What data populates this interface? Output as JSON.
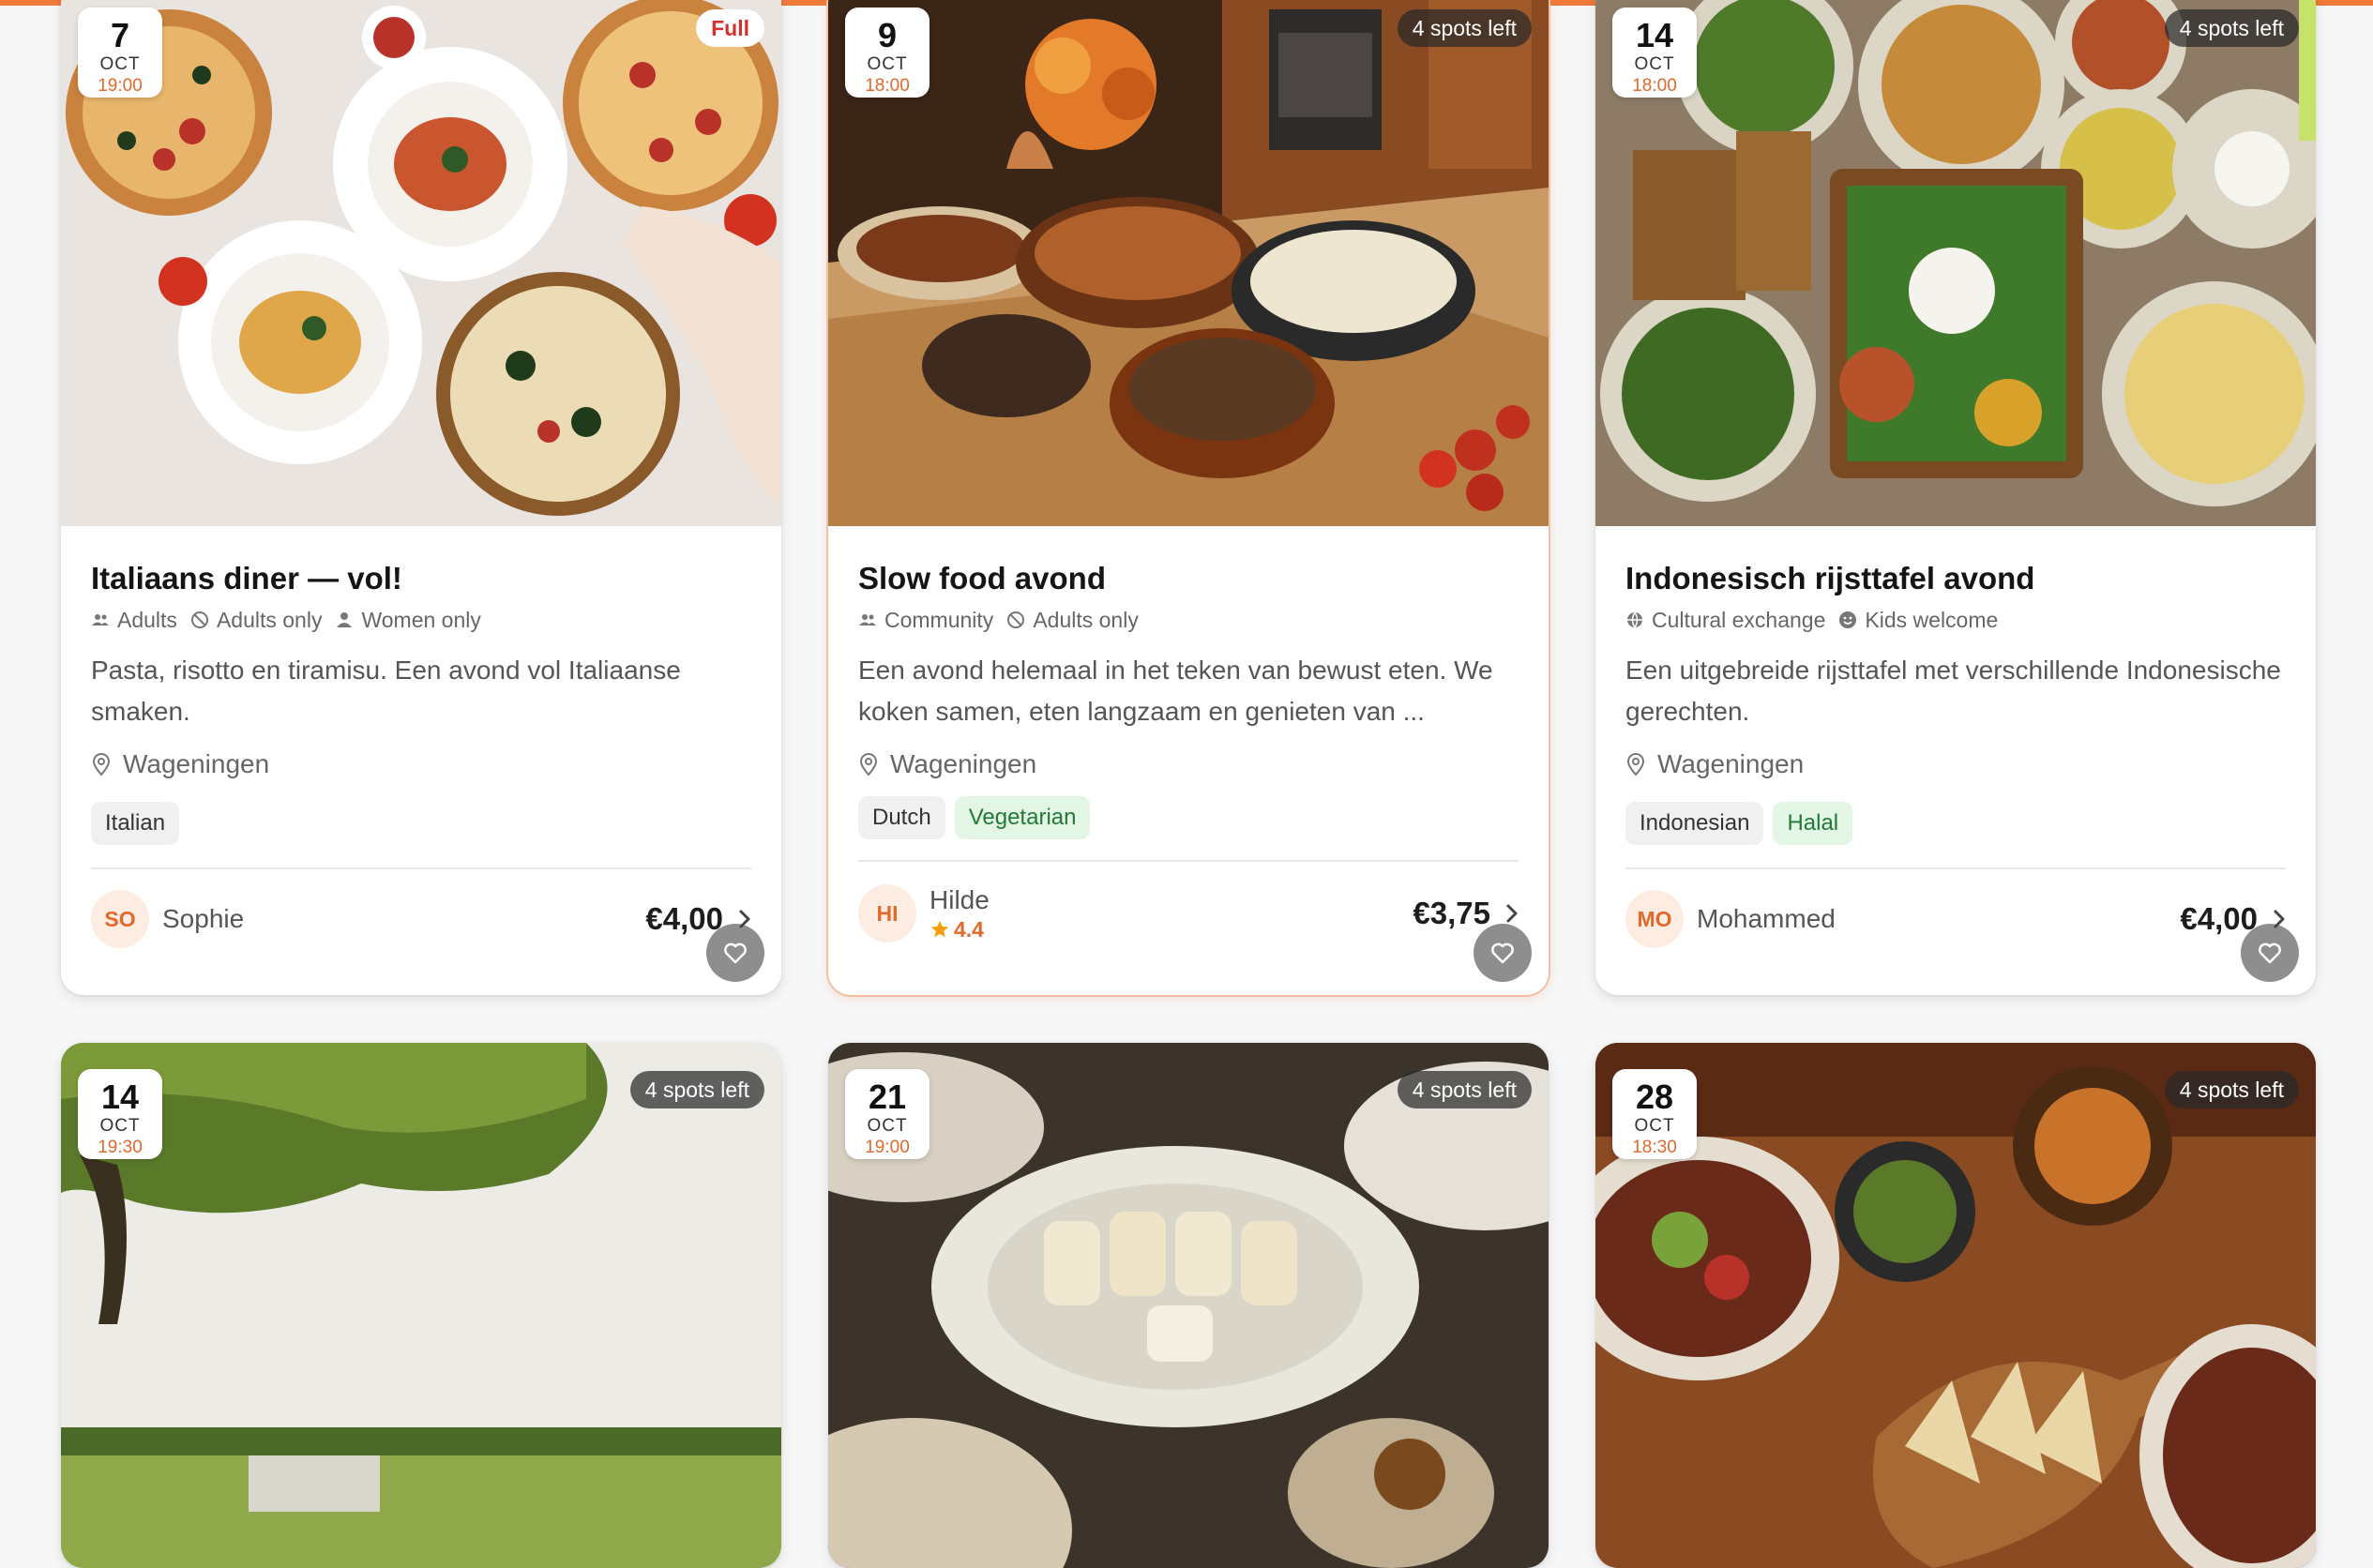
{
  "cards": [
    {
      "day": "7",
      "month": "OCT",
      "time": "19:00",
      "badge": "Full",
      "title": "Italiaans diner — vol!",
      "meta": [
        "Adults",
        "Adults only",
        "Women only"
      ],
      "description": "Pasta, risotto en tiramisu. Een avond vol Italiaanse smaken.",
      "location": "Wageningen",
      "tags": [
        "Italian"
      ],
      "host_initials": "SO",
      "host_name": "Sophie",
      "price": "€4,00"
    },
    {
      "day": "9",
      "month": "OCT",
      "time": "18:00",
      "badge": "4 spots left",
      "title": "Slow food avond",
      "meta": [
        "Community",
        "Adults only"
      ],
      "description": "Een avond helemaal in het teken van bewust eten. We koken samen, eten langzaam en genieten van ...",
      "location": "Wageningen",
      "tags": [
        "Dutch",
        "Vegetarian"
      ],
      "host_initials": "HI",
      "host_name": "Hilde",
      "rating": "4.4",
      "price": "€3,75"
    },
    {
      "day": "14",
      "month": "OCT",
      "time": "18:00",
      "badge": "4 spots left",
      "title": "Indonesisch rijsttafel avond",
      "meta": [
        "Cultural exchange",
        "Kids welcome"
      ],
      "description": "Een uitgebreide rijsttafel met verschillende Indonesische gerechten.",
      "location": "Wageningen",
      "tags": [
        "Indonesian",
        "Halal"
      ],
      "host_initials": "MO",
      "host_name": "Mohammed",
      "price": "€4,00"
    },
    {
      "day": "14",
      "month": "OCT",
      "time": "19:30",
      "badge": "4 spots left"
    },
    {
      "day": "21",
      "month": "OCT",
      "time": "19:00",
      "badge": "4 spots left"
    },
    {
      "day": "28",
      "month": "OCT",
      "time": "18:30",
      "badge": "4 spots left"
    }
  ],
  "icons": {
    "favorite": "heart-icon",
    "location": "map-pin-icon",
    "chevron": "chevron-right-icon",
    "star": "star-icon",
    "people": "people-icon",
    "no_kids": "ban-icon",
    "person": "person-icon",
    "globe": "globe-icon",
    "smile": "smile-icon"
  },
  "colors": {
    "accent": "#f07a3a",
    "full": "#d62f2f",
    "green_tag": "#207a35"
  }
}
